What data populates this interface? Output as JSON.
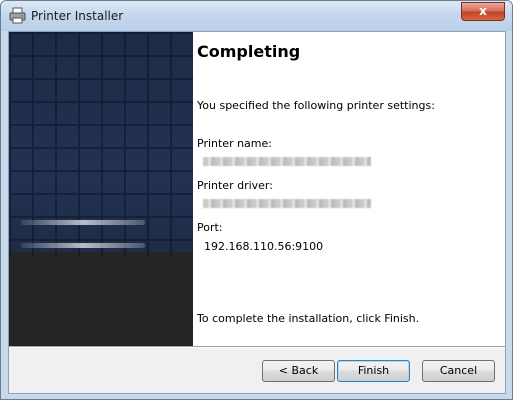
{
  "window": {
    "title": "Printer Installer",
    "close_glyph": "x"
  },
  "page": {
    "heading": "Completing",
    "intro": "You specified the following printer settings:",
    "printer_name_label": "Printer name:",
    "printer_driver_label": "Printer driver:",
    "port_label": "Port:",
    "port_value": "192.168.110.56:9100",
    "footer": "To complete the installation, click Finish."
  },
  "buttons": {
    "back": "< Back",
    "finish": "Finish",
    "cancel": "Cancel"
  },
  "icons": {
    "app": "printer-icon",
    "close": "close-icon"
  },
  "colors": {
    "side_panel_top": "#1e2b47",
    "side_panel_bottom": "#252525",
    "close_button": "#c1442a",
    "default_button_border": "#3c7fb1"
  }
}
